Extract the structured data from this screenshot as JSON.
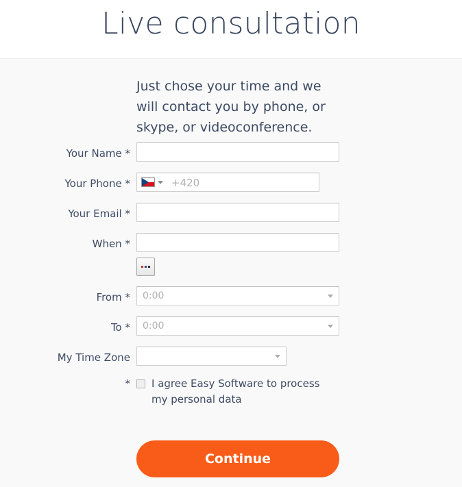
{
  "header": {
    "title": "Live consultation"
  },
  "intro": {
    "text": "Just chose your time and we will contact you by phone, or skype, or videoconference."
  },
  "form": {
    "name": {
      "label": "Your Name *",
      "value": "",
      "placeholder": ""
    },
    "phone": {
      "label": "Your Phone *",
      "country_flag": "czech-republic-flag",
      "value": "",
      "placeholder": "+420"
    },
    "email": {
      "label": "Your Email *",
      "value": "",
      "placeholder": ""
    },
    "when": {
      "label": "When *",
      "value": "",
      "placeholder": "",
      "picker_button_label": "..."
    },
    "from": {
      "label": "From *",
      "value": "0:00"
    },
    "to": {
      "label": "To *",
      "value": "0:00"
    },
    "timezone": {
      "label": "My Time Zone",
      "value": ""
    },
    "consent": {
      "required_mark": "*",
      "text": "I agree Easy Software to process my personal data",
      "checked": false
    },
    "submit": {
      "label": "Continue"
    }
  },
  "colors": {
    "title": "#39465e",
    "text": "#3c4a63",
    "accent_orange": "#f95c18",
    "page_background": "#f9f9f9",
    "header_background": "#ffffff",
    "field_border": "#cfcfcf",
    "placeholder": "#b0b0b0"
  }
}
